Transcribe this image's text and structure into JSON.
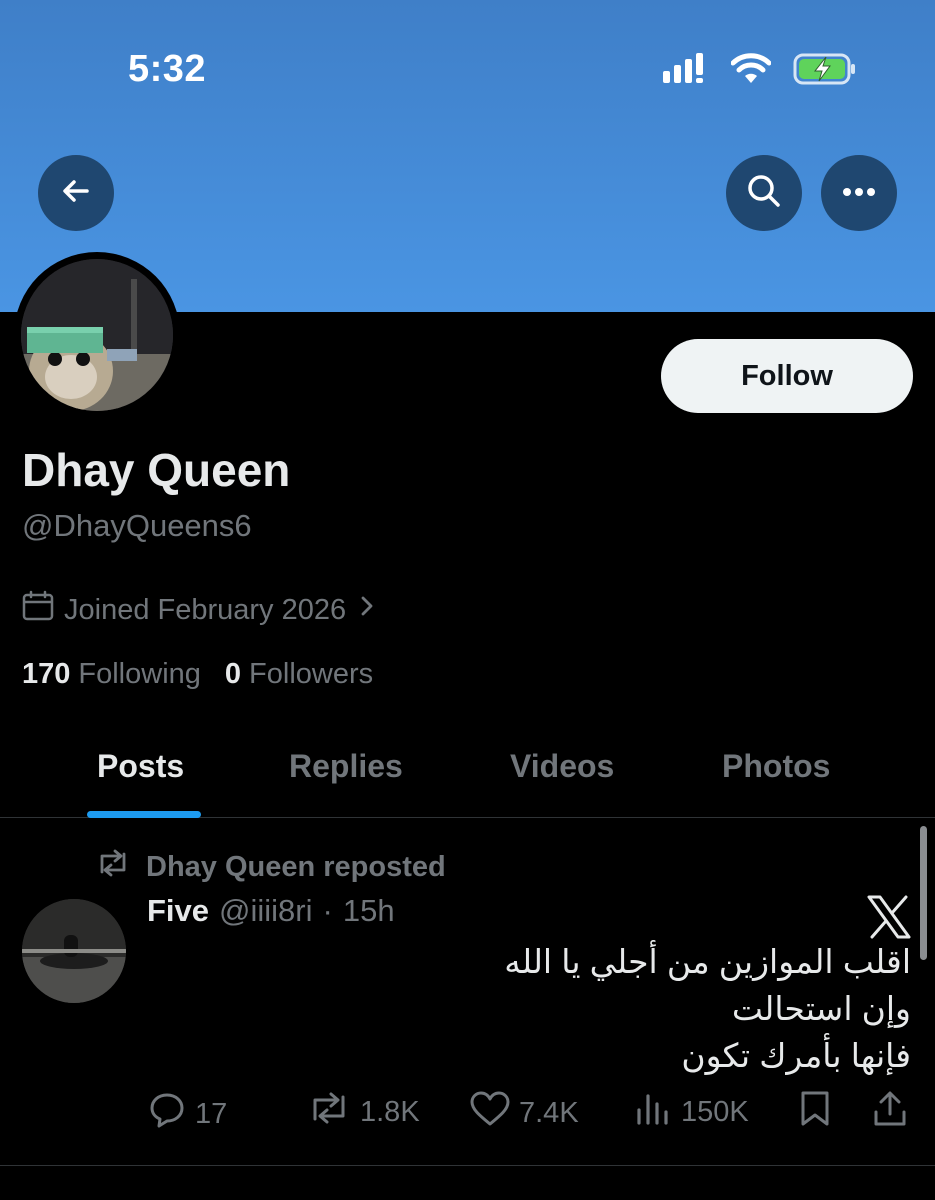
{
  "status_bar": {
    "time": "5:32"
  },
  "profile": {
    "display_name": "Dhay Queen",
    "handle": "@DhayQueens6",
    "joined": "Joined February 2026",
    "following_count": "170",
    "following_label": "Following",
    "followers_count": "0",
    "followers_label": "Followers",
    "follow_button": "Follow"
  },
  "tabs": [
    {
      "label": "Posts",
      "active": true
    },
    {
      "label": "Replies",
      "active": false
    },
    {
      "label": "Videos",
      "active": false
    },
    {
      "label": "Photos",
      "active": false
    }
  ],
  "post": {
    "repost_label": "Dhay Queen reposted",
    "author_name": "Five",
    "author_handle": "@iiii8ri",
    "separator": "·",
    "time": "15h",
    "text_lines": [
      "اقلب الموازين من أجلي يا الله",
      "وإن استحالت",
      "فإنها بأمرك تكون"
    ],
    "replies": "17",
    "reposts": "1.8K",
    "likes": "7.4K",
    "views": "150K"
  },
  "colors": {
    "banner": "#4a95e3",
    "accent": "#1d9bf0",
    "muted_text": "#71767b",
    "primary_text": "#e7e9ea",
    "battery_green": "#5fd35b"
  },
  "icons": [
    "signal-icon",
    "wifi-icon",
    "battery-charging-icon",
    "back-arrow-icon",
    "search-icon",
    "more-icon",
    "calendar-icon",
    "chevron-right-icon",
    "repost-icon",
    "x-logo-icon",
    "reply-icon",
    "like-icon",
    "views-icon",
    "bookmark-icon",
    "share-icon"
  ]
}
